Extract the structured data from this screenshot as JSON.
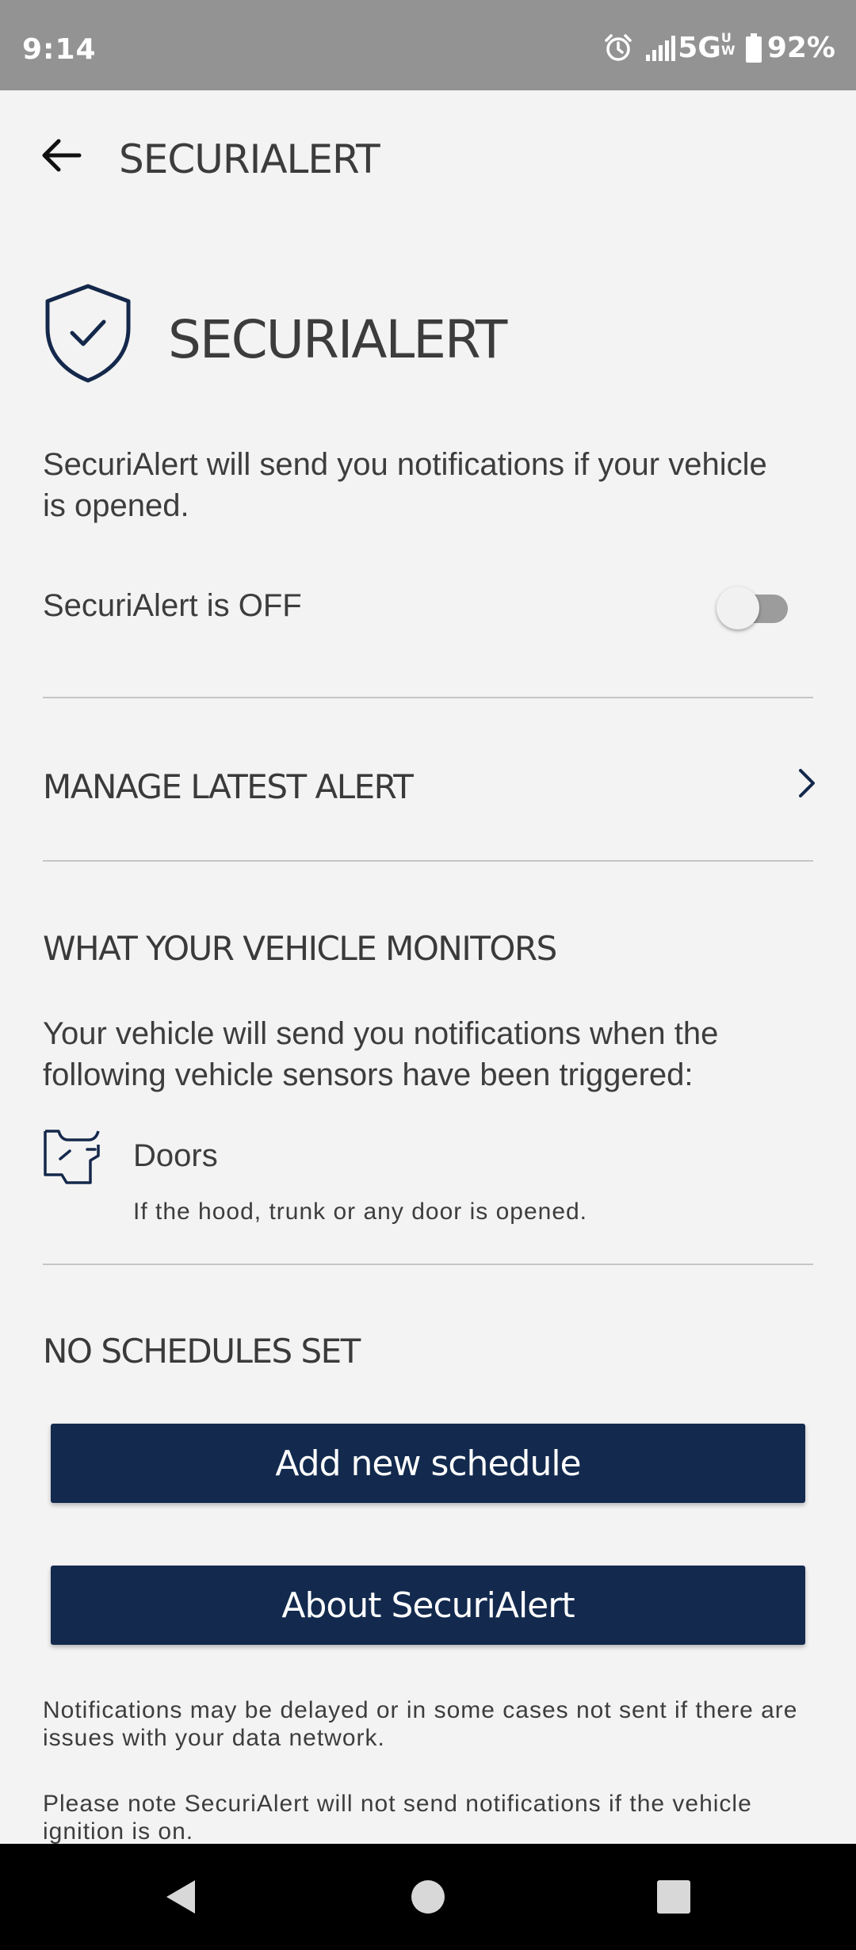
{
  "status_bar": {
    "time": "9:14",
    "network": "5G",
    "network_sup": "UW",
    "battery": "92%"
  },
  "app_bar": {
    "title": "SECURIALERT"
  },
  "hero": {
    "title": "SECURIALERT",
    "description": "SecuriAlert will send you notifications if your vehicle is opened."
  },
  "toggle": {
    "label": "SecuriAlert is OFF",
    "on": false
  },
  "manage_alert": {
    "label": "MANAGE LATEST ALERT"
  },
  "monitors": {
    "heading": "WHAT YOUR VEHICLE MONITORS",
    "description": "Your vehicle will send you notifications when the following vehicle sensors have been triggered:",
    "items": [
      {
        "label": "Doors",
        "description": "If the hood, trunk or any door is opened."
      }
    ]
  },
  "schedules": {
    "heading": "NO SCHEDULES SET",
    "add_button": "Add new schedule",
    "about_button": "About SecuriAlert"
  },
  "notes": [
    "Notifications may be delayed or in some cases not sent if there are issues with your data network.",
    "Please note SecuriAlert will not send notifications if the vehicle ignition is on."
  ],
  "colors": {
    "background": "#f3f3f3",
    "status_bar": "#939393",
    "button": "#132a4e",
    "icon_navy": "#14284b",
    "divider": "#c5c5c5"
  }
}
